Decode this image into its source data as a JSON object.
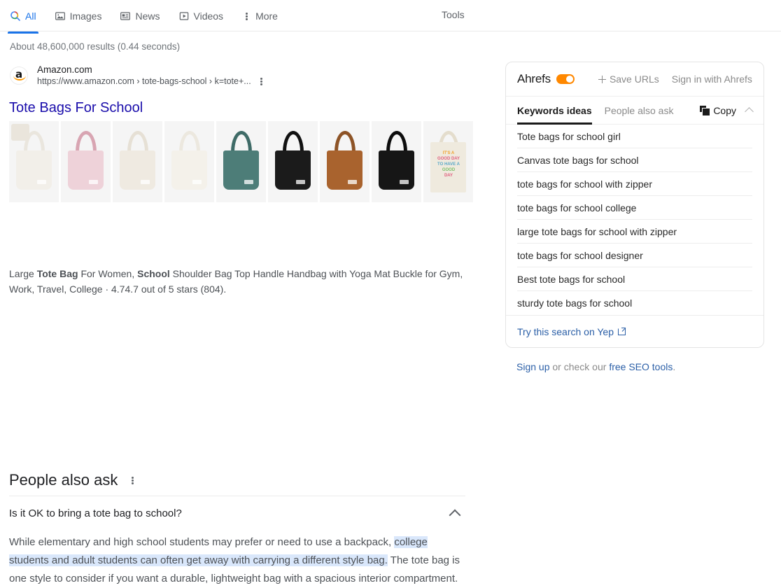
{
  "nav": {
    "items": [
      {
        "label": "All",
        "icon": "search-icon",
        "active": true
      },
      {
        "label": "Images",
        "icon": "image-icon",
        "active": false
      },
      {
        "label": "News",
        "icon": "news-icon",
        "active": false
      },
      {
        "label": "Videos",
        "icon": "video-icon",
        "active": false
      },
      {
        "label": "More",
        "icon": "kebab-icon",
        "active": false
      }
    ],
    "tools_label": "Tools"
  },
  "stats": "About 48,600,000 results (0.44 seconds)",
  "result": {
    "site_name": "Amazon.com",
    "url": "https://www.amazon.com › tote-bags-school › k=tote+...",
    "title": "Tote Bags For School",
    "description_parts": [
      {
        "text": "Large ",
        "bold": false
      },
      {
        "text": "Tote Bag",
        "bold": true
      },
      {
        "text": " For Women, ",
        "bold": false
      },
      {
        "text": "School",
        "bold": true
      },
      {
        "text": " Shoulder Bag Top Handle Handbag with Yoga Mat Buckle for Gym, Work, Travel, College · 4.74.7 out of 5 stars (804).",
        "bold": false
      }
    ],
    "thumbnails": [
      {
        "name": "cream-shoulder-tote",
        "body": "#f2efe9",
        "strap": "#eae6de"
      },
      {
        "name": "pink-quilted-tote",
        "body": "#eed2d9",
        "strap": "#d8a5b2"
      },
      {
        "name": "ivory-slouch-tote",
        "body": "#efeae1",
        "strap": "#e6e0d5"
      },
      {
        "name": "white-handbag-tote",
        "body": "#f4f1ea",
        "strap": "#ece8df"
      },
      {
        "name": "teal-laptop-tote",
        "body": "#4d7d78",
        "strap": "#3f6b67"
      },
      {
        "name": "black-structured-tote",
        "body": "#1b1b1b",
        "strap": "#111111"
      },
      {
        "name": "brown-corduroy-tote",
        "body": "#a9632e",
        "strap": "#8d5326"
      },
      {
        "name": "black-corduroy-tote",
        "body": "#161616",
        "strap": "#0d0d0d"
      },
      {
        "name": "good-day-canvas-tote",
        "body": "#efeade",
        "strap": "#e4ddcd"
      }
    ]
  },
  "paa": {
    "title": "People also ask",
    "question": "Is it OK to bring a tote bag to school?",
    "answer_parts": [
      {
        "text": "While elementary and high school students may prefer or need to use a backpack, ",
        "highlight": false
      },
      {
        "text": "college students and adult students can often get away with carrying a different style bag.",
        "highlight": true
      },
      {
        "text": " The tote bag is one style to consider if you want a durable, lightweight bag with a spacious interior compartment.",
        "highlight": false
      }
    ]
  },
  "ahrefs": {
    "brand": "Ahrefs",
    "toggle_on": true,
    "toggle_color": "#ff8800",
    "save_urls_label": "Save URLs",
    "signin_label": "Sign in with Ahrefs",
    "tabs": [
      {
        "label": "Keywords ideas",
        "active": true
      },
      {
        "label": "People also ask",
        "active": false
      }
    ],
    "copy_label": "Copy",
    "keywords": [
      "Tote bags for school girl",
      "Canvas tote bags for school",
      "tote bags for school with zipper",
      "tote bags for school college",
      "large tote bags for school with zipper",
      "tote bags for school designer",
      "Best tote bags for school",
      "sturdy tote bags for school"
    ],
    "yep_label": "Try this search on Yep",
    "footer": {
      "signup": "Sign up",
      "middle": " or check our ",
      "tools": "free SEO tools",
      "period": "."
    }
  }
}
